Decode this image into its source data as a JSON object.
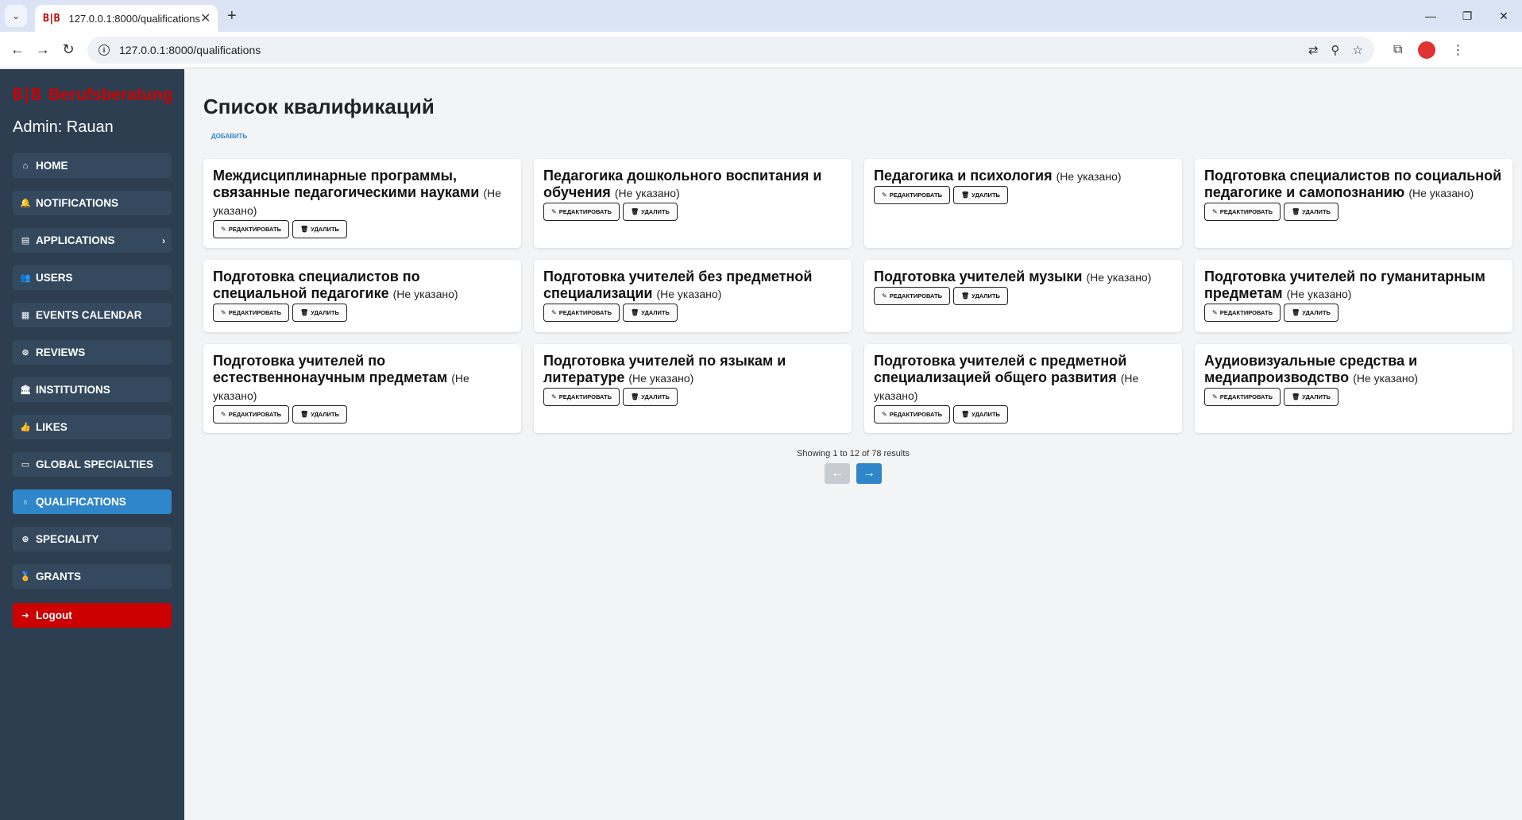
{
  "browser": {
    "tab_title": "127.0.0.1:8000/qualifications",
    "favicon": "B|B",
    "url": "127.0.0.1:8000/qualifications"
  },
  "sidebar": {
    "brand_logo": "B|B",
    "brand_name": "Berufsberatung",
    "admin": "Admin: Rauan",
    "items": [
      {
        "label": "HOME",
        "icon": "home-icon",
        "glyph": "⌂"
      },
      {
        "label": "NOTIFICATIONS",
        "icon": "bell-icon",
        "glyph": "🔔"
      },
      {
        "label": "APPLICATIONS",
        "icon": "clipboard-icon",
        "glyph": "▤"
      },
      {
        "label": "USERS",
        "icon": "users-icon",
        "glyph": "👥"
      },
      {
        "label": "EVENTS CALENDAR",
        "icon": "calendar-icon",
        "glyph": "▦"
      },
      {
        "label": "REVIEWS",
        "icon": "reviews-icon",
        "glyph": "⊛"
      },
      {
        "label": "INSTITUTIONS",
        "icon": "institution-icon",
        "glyph": "🏛"
      },
      {
        "label": "LIKES",
        "icon": "thumbs-up-icon",
        "glyph": "👍"
      },
      {
        "label": "GLOBAL SPECIALTIES",
        "icon": "briefcase-icon",
        "glyph": "▭"
      },
      {
        "label": "QUALIFICATIONS",
        "icon": "lightbulb-icon",
        "glyph": "♁"
      },
      {
        "label": "SPECIALITY",
        "icon": "globe-icon",
        "glyph": "⊕"
      },
      {
        "label": "GRANTS",
        "icon": "medal-icon",
        "glyph": "🏅"
      }
    ],
    "logout": "Logout",
    "active_color": "#2f86c9",
    "logout_color": "#cc0000"
  },
  "main": {
    "title": "Список квалификаций",
    "add_label": "ДОБАВИТЬ",
    "edit_label": "РЕДАКТИРОВАТЬ",
    "delete_label": "УДАЛИТЬ",
    "cards": [
      {
        "title": "Междисциплинарные программы, связанные педагогическими науками",
        "status": "(Не указано)"
      },
      {
        "title": "Педагогика дошкольного воспитания и обучения",
        "status": "(Не указано)"
      },
      {
        "title": "Педагогика и психология",
        "status": "(Не указано)"
      },
      {
        "title": "Подготовка специалистов по социальной педагогике и самопознанию",
        "status": "(Не указано)"
      },
      {
        "title": "Подготовка специалистов по специальной педагогике",
        "status": "(Не указано)"
      },
      {
        "title": "Подготовка учителей без предметной специализации",
        "status": "(Не указано)"
      },
      {
        "title": "Подготовка учителей музыки",
        "status": "(Не указано)"
      },
      {
        "title": "Подготовка учителей по гуманитарным предметам",
        "status": "(Не указано)"
      },
      {
        "title": "Подготовка учителей по естественнонаучным предметам",
        "status": "(Не указано)"
      },
      {
        "title": "Подготовка учителей по языкам и литературе",
        "status": "(Не указано)"
      },
      {
        "title": "Подготовка учителей с предметной специализацией общего развития",
        "status": "(Не указано)"
      },
      {
        "title": "Аудиовизуальные средства и медиапроизводство",
        "status": "(Не указано)"
      }
    ],
    "pagination_info": "Showing 1 to 12 of 78 results",
    "prev_glyph": "←",
    "next_glyph": "→"
  }
}
